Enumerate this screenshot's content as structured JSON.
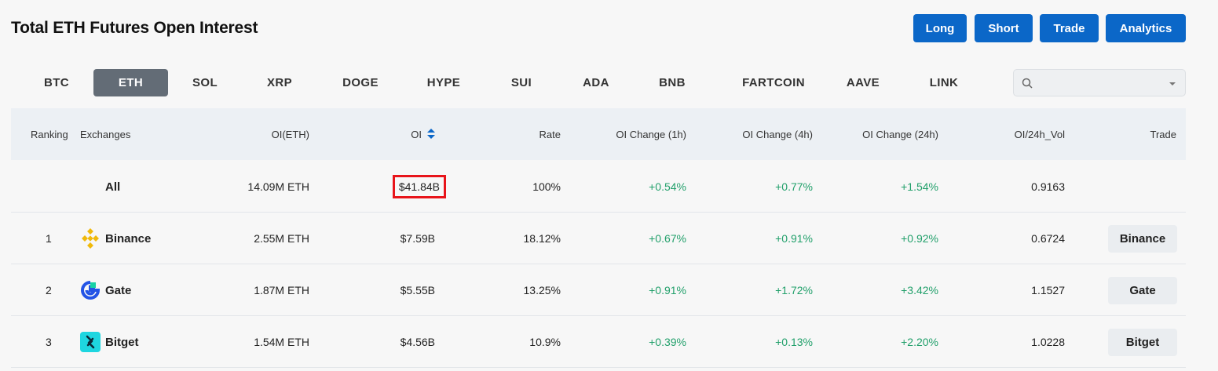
{
  "header": {
    "title": "Total ETH Futures Open Interest",
    "actions": [
      "Long",
      "Short",
      "Trade",
      "Analytics"
    ]
  },
  "coin_tabs": [
    "BTC",
    "ETH",
    "SOL",
    "XRP",
    "DOGE",
    "HYPE",
    "SUI",
    "ADA",
    "BNB",
    "FARTCOIN",
    "AAVE",
    "LINK"
  ],
  "active_tab": "ETH",
  "search": {
    "placeholder": "",
    "value": ""
  },
  "table": {
    "columns": [
      "Ranking",
      "Exchanges",
      "OI(ETH)",
      "OI",
      "Rate",
      "OI Change (1h)",
      "OI Change (4h)",
      "OI Change (24h)",
      "OI/24h_Vol",
      "Trade"
    ],
    "sorted_column": "OI",
    "rows": [
      {
        "ranking": "",
        "exchange": "All",
        "oi_eth": "14.09M ETH",
        "oi": "$41.84B",
        "rate": "100%",
        "ch1h": "+0.54%",
        "ch4h": "+0.77%",
        "ch24h": "+1.54%",
        "oi_vol": "0.9163",
        "trade": ""
      },
      {
        "ranking": "1",
        "exchange": "Binance",
        "logo": "binance-logo-icon",
        "oi_eth": "2.55M ETH",
        "oi": "$7.59B",
        "rate": "18.12%",
        "ch1h": "+0.67%",
        "ch4h": "+0.91%",
        "ch24h": "+0.92%",
        "oi_vol": "0.6724",
        "trade": "Binance"
      },
      {
        "ranking": "2",
        "exchange": "Gate",
        "logo": "gate-logo-icon",
        "oi_eth": "1.87M ETH",
        "oi": "$5.55B",
        "rate": "13.25%",
        "ch1h": "+0.91%",
        "ch4h": "+1.72%",
        "ch24h": "+3.42%",
        "oi_vol": "1.1527",
        "trade": "Gate"
      },
      {
        "ranking": "3",
        "exchange": "Bitget",
        "logo": "bitget-logo-icon",
        "oi_eth": "1.54M ETH",
        "oi": "$4.56B",
        "rate": "10.9%",
        "ch1h": "+0.39%",
        "ch4h": "+0.13%",
        "ch24h": "+2.20%",
        "oi_vol": "1.0228",
        "trade": "Bitget"
      }
    ]
  },
  "colors": {
    "primary": "#0b67c8",
    "active_tab": "#636c76",
    "positive": "#22a06b",
    "highlight": "#e8141a",
    "binance": "#f0b90b",
    "gate": "#2354e6",
    "bitget": "#1ed6e0"
  }
}
